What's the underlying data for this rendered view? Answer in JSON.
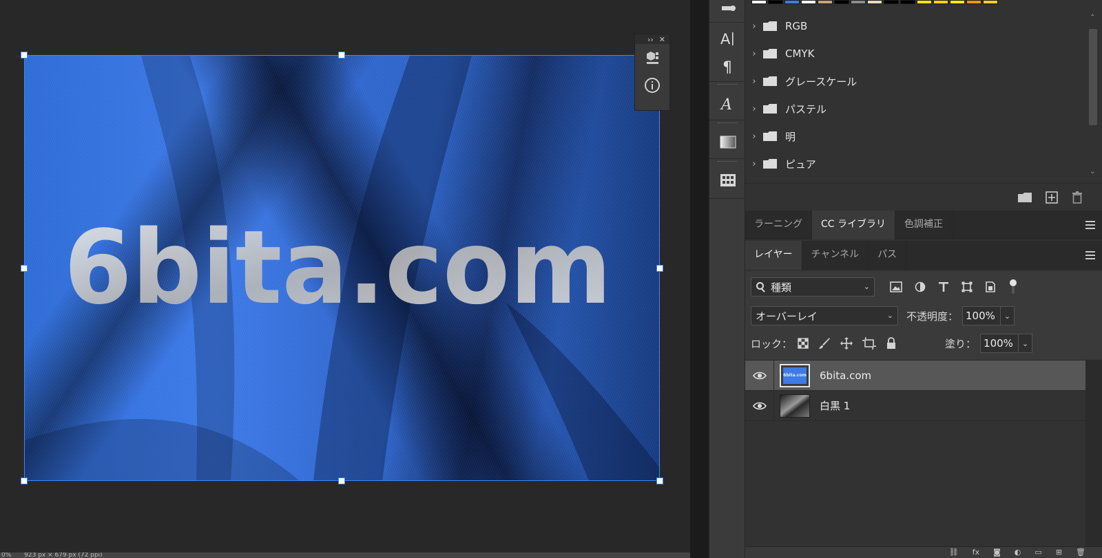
{
  "canvas": {
    "artwork_text": "6bita.com",
    "status_bar": {
      "zoom": "0%",
      "dimensions": "923 px × 679 px (72 ppi)"
    }
  },
  "swatches": {
    "colors": [
      "#ffffff",
      "#000000",
      "#3f7bdc",
      "#ffffff",
      "#c8a27a",
      "#000000",
      "#8c8c8c",
      "#e6dcc0",
      "#000000",
      "#000000",
      "#ffe600",
      "#ffd500",
      "#ffee00",
      "#e89a00",
      "#ffcc33"
    ],
    "groups": [
      "RGB",
      "CMYK",
      "グレースケール",
      "パステル",
      "明",
      "ピュア"
    ]
  },
  "upper_tabs": [
    "ラーニング",
    "CC ライブラリ",
    "色調補正"
  ],
  "layers_tabs": [
    "レイヤー",
    "チャンネル",
    "パス"
  ],
  "layer_controls": {
    "filter_kind": "種類",
    "blend_mode": "オーバーレイ",
    "opacity_label": "不透明度：",
    "opacity_value": "100%",
    "lock_label": "ロック：",
    "fill_label": "塗り：",
    "fill_value": "100%"
  },
  "layers": [
    {
      "name": "6bita.com",
      "selected": true,
      "thumb_text": "6bita.com"
    },
    {
      "name": "白黒 1",
      "selected": false
    }
  ],
  "icons": {
    "float_panel": [
      "cube-3d-icon",
      "info-icon"
    ],
    "tools": [
      "paragraph-style-icon",
      "character-icon",
      "paragraph-icon",
      "glyphs-icon",
      "gradient-icon",
      "table-icon"
    ],
    "swatch_footer": [
      "new-group-folder-icon",
      "new-swatch-icon",
      "trash-icon"
    ],
    "layer_filters": [
      "image-filter-icon",
      "adjustment-filter-icon",
      "type-filter-icon",
      "shape-filter-icon",
      "smart-object-filter-icon",
      "filter-toggle-icon"
    ],
    "locks": [
      "lock-transparent-pixels-icon",
      "lock-image-pixels-icon",
      "lock-position-icon",
      "lock-artboard-icon",
      "lock-all-icon"
    ],
    "layers_footer": [
      "link-layers-icon",
      "fx-icon",
      "mask-icon",
      "adjustment-layer-icon",
      "group-icon",
      "new-layer-icon",
      "delete-layer-icon"
    ]
  }
}
